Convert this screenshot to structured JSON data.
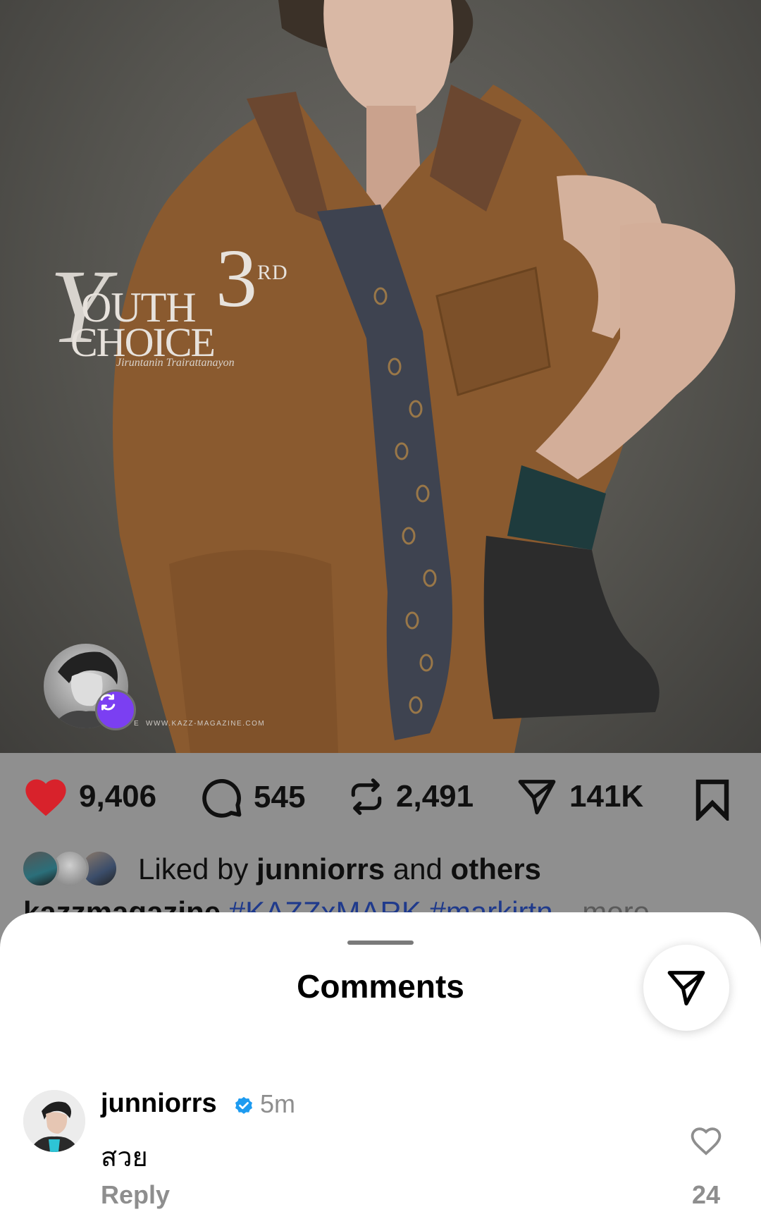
{
  "post": {
    "image_alt": "Magazine cover photo of a young man in a brown short-sleeve shirt and shorts with a patterned tie, crouching against a grey backdrop",
    "overlay": {
      "logo_y": "Y",
      "logo_youth": "OUTH",
      "logo_choice": "CHOICE",
      "logo_3": "3",
      "logo_rd": "RD",
      "logo_signature": "Jiruntanin Trairattanayon",
      "web_prefix": "E",
      "web_credit": "WWW.KAZZ-MAGAZINE.COM"
    },
    "stats": {
      "likes": "9,406",
      "comments": "545",
      "reposts": "2,491",
      "shares": "141K"
    },
    "liked_by": {
      "prefix": "Liked by ",
      "user": "junniorrs",
      "middle": " and ",
      "others": "others"
    },
    "caption": {
      "user": "kazzmagazine",
      "tag1": "#KAZZxMARK",
      "tag2": "#markirtn",
      "more": "more"
    }
  },
  "comments_sheet": {
    "title": "Comments",
    "comments": [
      {
        "user": "junniorrs",
        "time": "5m",
        "text": "สวย",
        "reply_label": "Reply",
        "like_count": "24"
      }
    ]
  },
  "colors": {
    "heart": "#d8222b",
    "repost_badge": "#7b3ff2",
    "verified": "#1d9bf0",
    "hashtag": "#1f3a8c"
  }
}
